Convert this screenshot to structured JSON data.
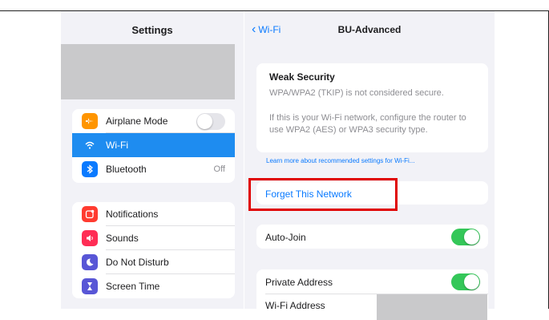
{
  "sidebar": {
    "title": "Settings",
    "group1": [
      {
        "label": "Airplane Mode",
        "icon": "airplane-icon",
        "color": "#ff9500"
      },
      {
        "label": "Wi-Fi",
        "icon": "wifi-icon",
        "color": "#1e8cf0"
      },
      {
        "label": "Bluetooth",
        "icon": "bluetooth-icon",
        "color": "#0a7aff",
        "value": "Off"
      }
    ],
    "group2": [
      {
        "label": "Notifications",
        "icon": "notifications-icon",
        "color": "#ff3b30"
      },
      {
        "label": "Sounds",
        "icon": "sounds-icon",
        "color": "#ff2d55"
      },
      {
        "label": "Do Not Disturb",
        "icon": "moon-icon",
        "color": "#5856d6"
      },
      {
        "label": "Screen Time",
        "icon": "hourglass-icon",
        "color": "#5856d6"
      }
    ]
  },
  "detail": {
    "back_label": "Wi-Fi",
    "title": "BU-Advanced",
    "warning": {
      "heading": "Weak Security",
      "line1": "WPA/WPA2 (TKIP) is not considered secure.",
      "line2": "If this is your Wi-Fi network, configure the router to use WPA2 (AES) or WPA3 security type."
    },
    "learn_more": "Learn more about recommended settings for Wi-Fi...",
    "forget": "Forget This Network",
    "auto_join": "Auto-Join",
    "private_address": "Private Address",
    "wifi_address": "Wi-Fi Address"
  },
  "colors": {
    "accent": "#0a7aff",
    "highlight": "#e00000",
    "toggle_on": "#34c759"
  }
}
